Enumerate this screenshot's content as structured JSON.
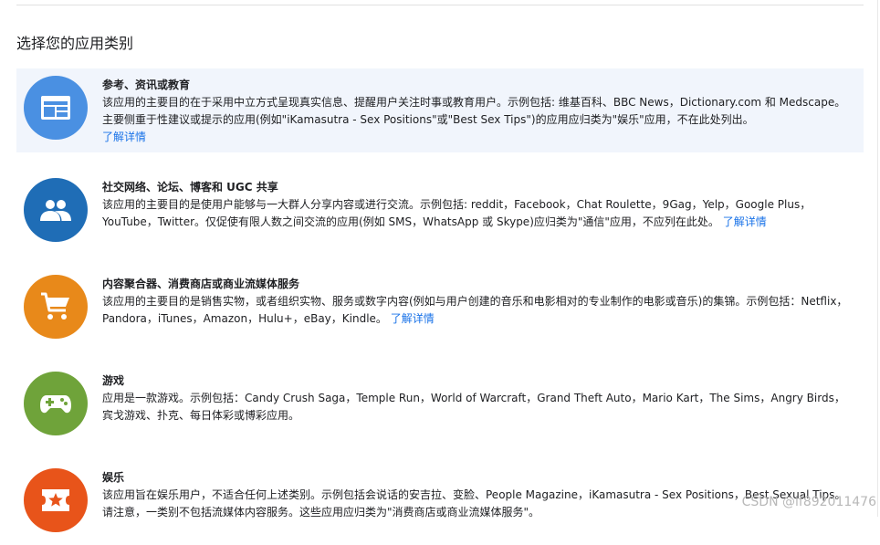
{
  "heading": "选择您的应用类别",
  "categories": [
    {
      "title": "参考、资讯或教育",
      "desc": "该应用的主要目的在于采用中立方式呈现真实信息、提醒用户关注时事或教育用户。示例包括: 维基百科、BBC News，Dictionary.com 和 Medscape。主要侧重于性建议或提示的应用(例如\"iKamasutra - Sex Positions\"或\"Best Sex Tips\")的应用应归类为\"娱乐\"应用，不在此处列出。",
      "link": "了解详情",
      "color": "#4a90e2",
      "icon": "news-article-icon"
    },
    {
      "title": "社交网络、论坛、博客和 UGC 共享",
      "desc": "该应用的主要目的是使用户能够与一大群人分享内容或进行交流。示例包括: reddit，Facebook，Chat Roulette，9Gag，Yelp，Google Plus，YouTube，Twitter。仅促使有限人数之间交流的应用(例如 SMS，WhatsApp 或 Skype)应归类为\"通信\"应用，不应列在此处。",
      "link": "了解详情",
      "color": "#1f6db6",
      "icon": "people-icon"
    },
    {
      "title": "内容聚合器、消费商店或商业流媒体服务",
      "desc": "该应用的主要目的是销售实物，或者组织实物、服务或数字内容(例如与用户创建的音乐和电影相对的专业制作的电影或音乐)的集锦。示例包括：Netflix，Pandora，iTunes，Amazon，Hulu+，eBay，Kindle。",
      "link": "了解详情",
      "color": "#e8891a",
      "icon": "shopping-cart-icon"
    },
    {
      "title": "游戏",
      "desc": "应用是一款游戏。示例包括：Candy Crush Saga，Temple Run，World of Warcraft，Grand Theft Auto，Mario Kart，The Sims，Angry Birds，宾戈游戏、扑克、每日体彩或博彩应用。",
      "link": "",
      "color": "#6fa33a",
      "icon": "gamepad-icon"
    },
    {
      "title": "娱乐",
      "desc": "该应用旨在娱乐用户，不适合任何上述类别。示例包括会说话的安吉拉、变脸、People Magazine，iKamasutra - Sex Positions，Best Sexual Tips。请注意，一类别不包括流媒体内容服务。这些应用应归类为\"消费商店或商业流媒体服务\"。",
      "link": "",
      "color": "#e8541a",
      "icon": "ticket-star-icon"
    }
  ],
  "watermark": "CSDN @lf892011476"
}
